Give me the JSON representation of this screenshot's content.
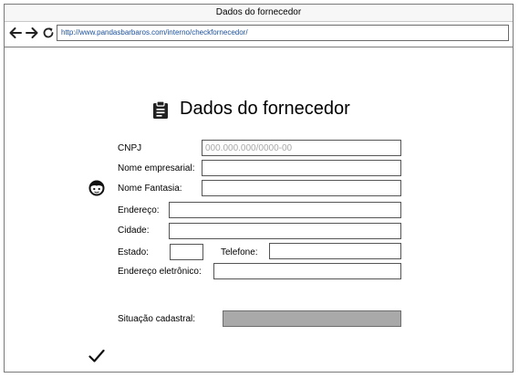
{
  "window": {
    "title": "Dados do fornecedor",
    "url": "http://www.pandasbarbaros.com/interno/checkfornecedor/"
  },
  "form": {
    "title": "Dados do fornecedor",
    "cnpj": {
      "label": "CNPJ",
      "placeholder": "000.000.000/0000-00",
      "value": ""
    },
    "nome_empresarial": {
      "label": "Nome empresarial:",
      "value": ""
    },
    "nome_fantasia": {
      "label": "Nome Fantasia:",
      "value": ""
    },
    "endereco": {
      "label": "Endereço:",
      "value": ""
    },
    "cidade": {
      "label": "Cidade:",
      "value": ""
    },
    "estado": {
      "label": "Estado:",
      "value": ""
    },
    "telefone": {
      "label": "Telefone:",
      "value": ""
    },
    "email": {
      "label": "Endereço eletrônico:",
      "value": ""
    },
    "situacao": {
      "label": "Situação cadastral:",
      "value": ""
    }
  },
  "icons": {
    "title": "clipboard-icon",
    "identity": "face-icon",
    "status": "checkmark-icon"
  }
}
